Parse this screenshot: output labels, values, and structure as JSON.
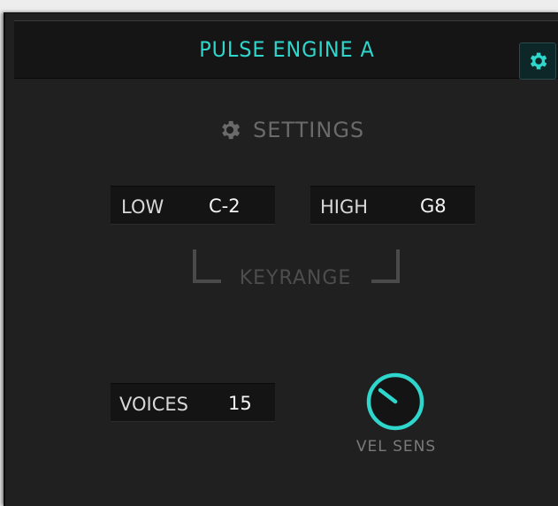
{
  "header": {
    "title": "PULSE ENGINE A",
    "settings_icon": "gear-icon"
  },
  "settings": {
    "icon": "gear-icon",
    "label": "SETTINGS"
  },
  "keyrange": {
    "label": "KEYRANGE",
    "low": {
      "label": "LOW",
      "value": "C-2"
    },
    "high": {
      "label": "HIGH",
      "value": "G8"
    }
  },
  "voices": {
    "label": "VOICES",
    "value": "15"
  },
  "vel_sens": {
    "label": "VEL SENS"
  },
  "colors": {
    "accent": "#2fd6cc",
    "panel": "#202020",
    "field": "#141414",
    "muted": "#4a4a4a"
  }
}
